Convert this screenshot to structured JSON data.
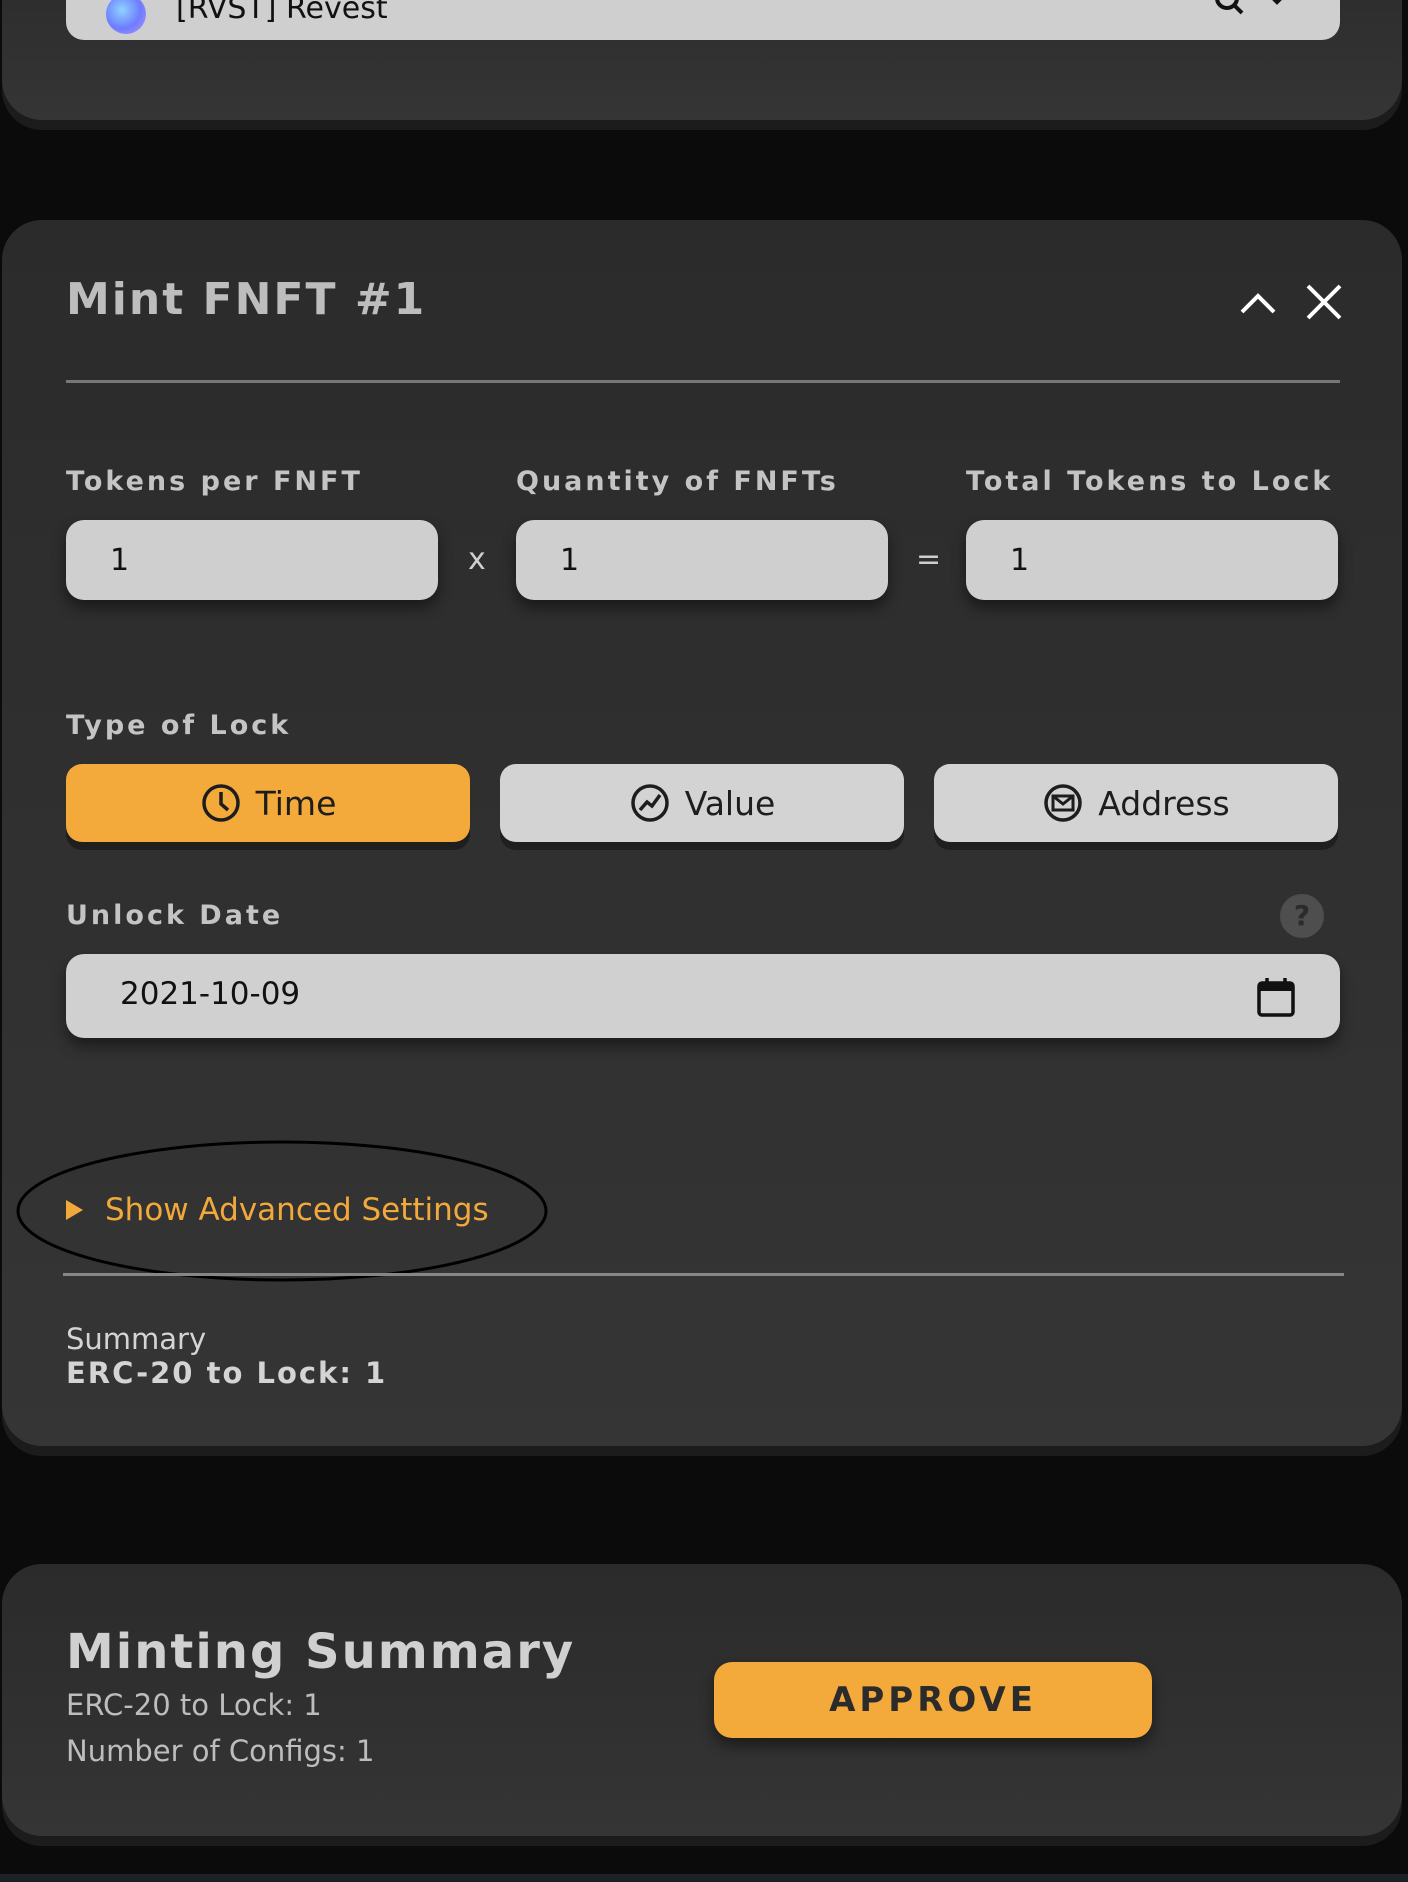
{
  "token_select": {
    "name": "[RVST] Revest"
  },
  "mint": {
    "title": "Mint FNFT #1",
    "tokens_per_fnft_label": "Tokens per FNFT",
    "tokens_per_fnft_value": "1",
    "quantity_label": "Quantity of FNFTs",
    "quantity_value": "1",
    "total_label": "Total Tokens to Lock",
    "total_value": "1",
    "multiply_symbol": "x",
    "equals_symbol": "=",
    "lock_type_label": "Type of Lock",
    "lock_types": [
      {
        "label": "Time",
        "icon": "clock-icon",
        "active": true
      },
      {
        "label": "Value",
        "icon": "chart-icon",
        "active": false
      },
      {
        "label": "Address",
        "icon": "mail-icon",
        "active": false
      }
    ],
    "unlock_date_label": "Unlock Date",
    "unlock_date_value": "2021-10-09",
    "help_symbol": "?",
    "advanced_label": "Show Advanced Settings",
    "summary_label": "Summary",
    "summary_value": "ERC-20 to Lock: 1"
  },
  "minting_summary": {
    "title": "Minting Summary",
    "erc20_line": "ERC-20 to Lock: 1",
    "configs_line": "Number of Configs: 1",
    "approve_label": "APPROVE"
  },
  "colors": {
    "accent": "#f4a93b",
    "card_bg": "#2f2f2f",
    "page_bg": "#0b0b0b",
    "input_bg": "#cfcfcf"
  }
}
